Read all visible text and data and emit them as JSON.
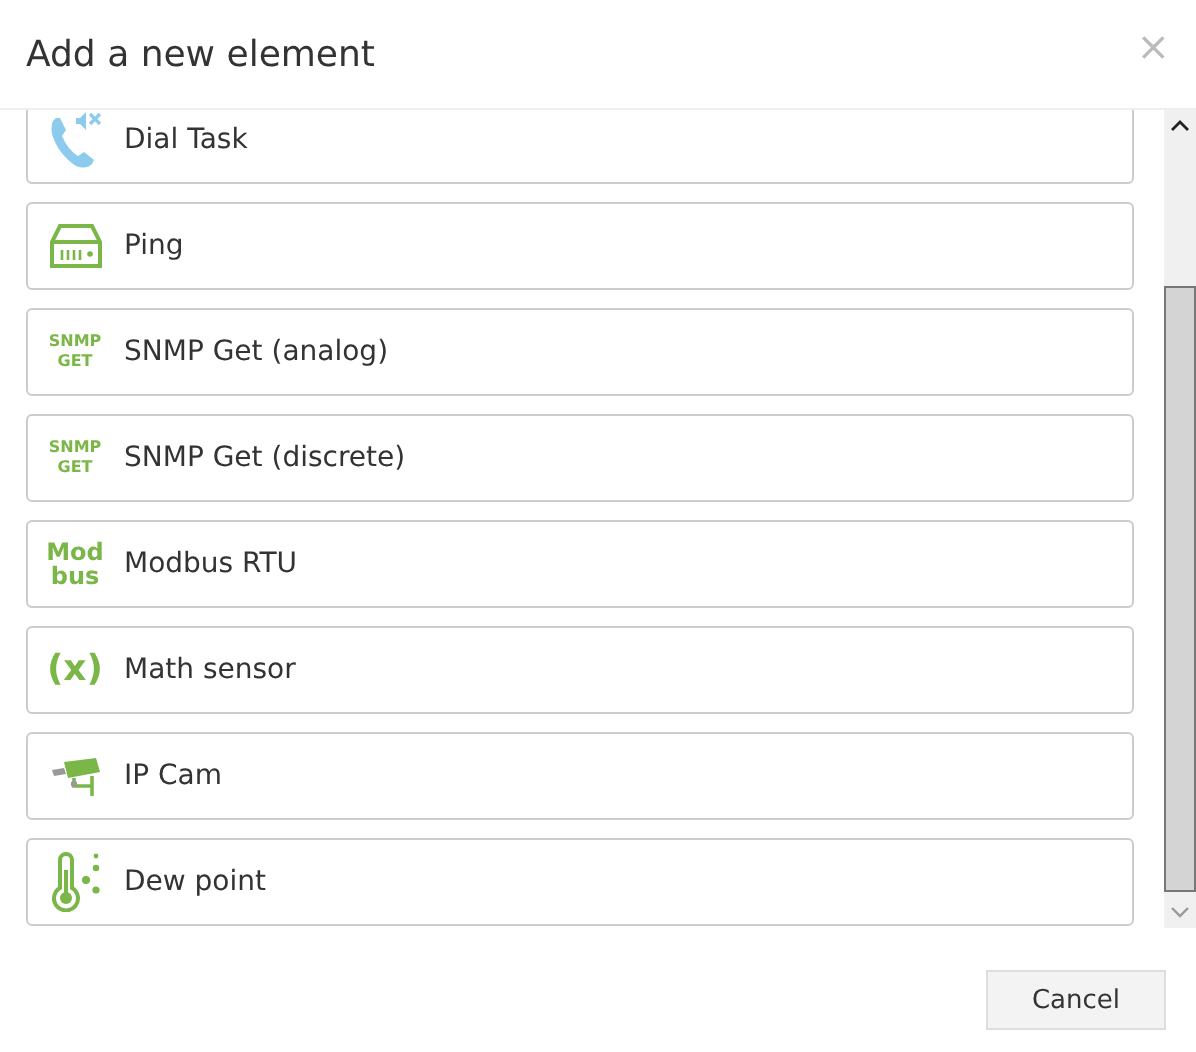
{
  "dialog": {
    "title": "Add a new element",
    "close": "×"
  },
  "elements": [
    {
      "label": "Dial Task",
      "kind": "phone"
    },
    {
      "label": "Ping",
      "kind": "device"
    },
    {
      "label": "SNMP Get (analog)",
      "kind": "text",
      "icon_lines": [
        "SNMP",
        "GET"
      ]
    },
    {
      "label": "SNMP Get (discrete)",
      "kind": "text",
      "icon_lines": [
        "SNMP",
        "GET"
      ]
    },
    {
      "label": "Modbus RTU",
      "kind": "bigtext",
      "icon_lines": [
        "Mod",
        "bus"
      ]
    },
    {
      "label": "Math sensor",
      "kind": "math",
      "icon_lines": [
        "(x)"
      ]
    },
    {
      "label": "IP Cam",
      "kind": "camera"
    },
    {
      "label": "Dew point",
      "kind": "thermometer"
    }
  ],
  "buttons": [
    "Cancel"
  ]
}
